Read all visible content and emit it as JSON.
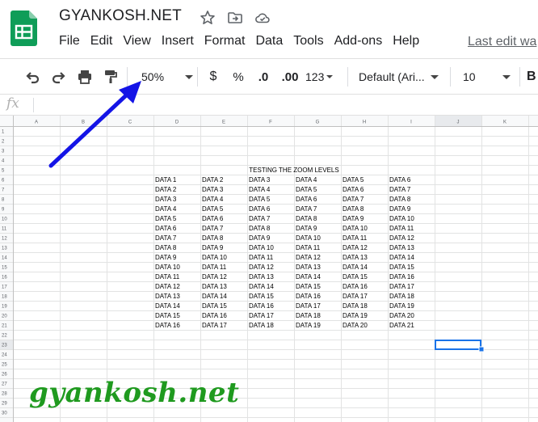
{
  "document": {
    "title": "GYANKOSH.NET"
  },
  "menu": [
    "File",
    "Edit",
    "View",
    "Insert",
    "Format",
    "Data",
    "Tools",
    "Add-ons",
    "Help"
  ],
  "last_edit": "Last edit wa",
  "toolbar": {
    "zoom": "50%",
    "currency": "$",
    "percent": "%",
    "decrease_decimal": ".0",
    "increase_decimal": ".00",
    "number_format": "123",
    "font_family": "Default (Ari...",
    "font_size": "10",
    "bold": "B"
  },
  "formula_bar": {
    "fx_label": "fx",
    "value": ""
  },
  "sheet": {
    "columns": [
      "A",
      "B",
      "C",
      "D",
      "E",
      "F",
      "G",
      "H",
      "I",
      "J",
      "K"
    ],
    "row_count": 30,
    "title_row": 5,
    "title": "TESTING THE ZOOM LEVELS",
    "data_start_row": 6,
    "data_start_col": "D",
    "table": [
      [
        "DATA 1",
        "DATA 2",
        "DATA 3",
        "DATA 4",
        "DATA 5",
        "DATA 6"
      ],
      [
        "DATA 2",
        "DATA 3",
        "DATA 4",
        "DATA 5",
        "DATA 6",
        "DATA 7"
      ],
      [
        "DATA 3",
        "DATA 4",
        "DATA 5",
        "DATA 6",
        "DATA 7",
        "DATA 8"
      ],
      [
        "DATA 4",
        "DATA 5",
        "DATA 6",
        "DATA 7",
        "DATA 8",
        "DATA 9"
      ],
      [
        "DATA 5",
        "DATA 6",
        "DATA 7",
        "DATA 8",
        "DATA 9",
        "DATA 10"
      ],
      [
        "DATA 6",
        "DATA 7",
        "DATA 8",
        "DATA 9",
        "DATA 10",
        "DATA 11"
      ],
      [
        "DATA 7",
        "DATA 8",
        "DATA 9",
        "DATA 10",
        "DATA 11",
        "DATA 12"
      ],
      [
        "DATA 8",
        "DATA 9",
        "DATA 10",
        "DATA 11",
        "DATA 12",
        "DATA 13"
      ],
      [
        "DATA 9",
        "DATA 10",
        "DATA 11",
        "DATA 12",
        "DATA 13",
        "DATA 14"
      ],
      [
        "DATA 10",
        "DATA 11",
        "DATA 12",
        "DATA 13",
        "DATA 14",
        "DATA 15"
      ],
      [
        "DATA 11",
        "DATA 12",
        "DATA 13",
        "DATA 14",
        "DATA 15",
        "DATA 16"
      ],
      [
        "DATA 12",
        "DATA 13",
        "DATA 14",
        "DATA 15",
        "DATA 16",
        "DATA 17"
      ],
      [
        "DATA 13",
        "DATA 14",
        "DATA 15",
        "DATA 16",
        "DATA 17",
        "DATA 18"
      ],
      [
        "DATA 14",
        "DATA 15",
        "DATA 16",
        "DATA 17",
        "DATA 18",
        "DATA 19"
      ],
      [
        "DATA 15",
        "DATA 16",
        "DATA 17",
        "DATA 18",
        "DATA 19",
        "DATA 20"
      ],
      [
        "DATA 16",
        "DATA 17",
        "DATA 18",
        "DATA 19",
        "DATA 20",
        "DATA 21"
      ]
    ],
    "selected_cell": "J23"
  },
  "watermark": "gyankosh.net",
  "colors": {
    "logo_green": "#0f9d58",
    "selection_blue": "#1a73e8",
    "arrow_blue": "#1414e6",
    "watermark_green": "#1f9a1f",
    "header_bg": "#f8f9fa",
    "selected_header_bg": "#e8eaed"
  },
  "icons": [
    "sheets-logo-icon",
    "star-icon",
    "move-to-folder-icon",
    "cloud-status-icon",
    "undo-icon",
    "redo-icon",
    "print-icon",
    "paint-format-icon",
    "chevron-down-icon",
    "fx-icon",
    "annotation-arrow"
  ]
}
